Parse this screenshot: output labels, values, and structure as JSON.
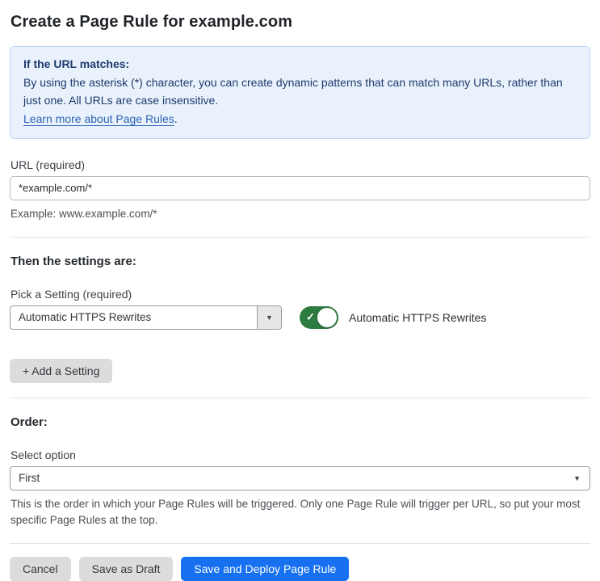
{
  "page": {
    "title": "Create a Page Rule for example.com"
  },
  "info_box": {
    "heading": "If the URL matches:",
    "body": "By using the asterisk (*) character, you can create dynamic patterns that can match many URLs, rather than just one. All URLs are case insensitive.",
    "link_text": "Learn more about Page Rules",
    "link_suffix": "."
  },
  "url_field": {
    "label": "URL (required)",
    "value": "*example.com/*",
    "helper": "Example: www.example.com/*"
  },
  "settings_section": {
    "heading": "Then the settings are:",
    "pick_setting_label": "Pick a Setting (required)",
    "selected_setting": "Automatic HTTPS Rewrites",
    "toggle_state": "on",
    "toggle_label": "Automatic HTTPS Rewrites",
    "add_setting_button": "+ Add a Setting"
  },
  "order_section": {
    "heading": "Order:",
    "select_label": "Select option",
    "selected_option": "First",
    "helper": "This is the order in which your Page Rules will be triggered. Only one Page Rule will trigger per URL, so put your most specific Page Rules at the top."
  },
  "footer": {
    "cancel_label": "Cancel",
    "save_draft_label": "Save as Draft",
    "deploy_label": "Save and Deploy Page Rule"
  },
  "icons": {
    "dropdown_arrow": "▼",
    "checkmark": "✓"
  },
  "colors": {
    "accent_blue": "#1670f0",
    "info_bg": "#e9f2fc",
    "info_border": "#b9d5f1",
    "info_text": "#1e3a6d",
    "link_blue": "#2c62b5",
    "toggle_green": "#2e7b41",
    "btn_gray": "#dcdcdc"
  }
}
